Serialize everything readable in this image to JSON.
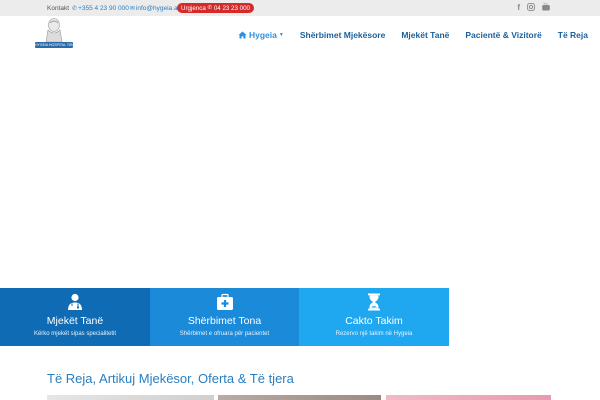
{
  "topbar": {
    "contact_label": "Kontakt",
    "phone": "+355 4 23 90 000",
    "email": "info@hygeia.al",
    "urgency_label": "Urgjenca",
    "urgency_phone": "04 23 23 000",
    "social": [
      "facebook-icon",
      "instagram-icon",
      "youtube-icon"
    ]
  },
  "logo": {
    "text": "HYGEIA HOSPITAL TIRANA"
  },
  "nav": {
    "items": [
      {
        "label": "Hygeia",
        "icon": "home-icon",
        "has_dropdown": true
      },
      {
        "label": "Shërbimet Mjekësore"
      },
      {
        "label": "Mjekët Tanë"
      },
      {
        "label": "Pacientë & Vizitorë"
      },
      {
        "label": "Të Reja"
      }
    ]
  },
  "features": [
    {
      "title": "Mjekët Tanë",
      "subtitle": "Kërko mjekët sipas specialitetit",
      "icon": "doctor-icon",
      "color": "#0f6bb4"
    },
    {
      "title": "Shërbimet Tona",
      "subtitle": "Shërbimet e ofruara për pacientet",
      "icon": "medical-kit-icon",
      "color": "#1a8ad9"
    },
    {
      "title": "Cakto Takim",
      "subtitle": "Rezervo një takim në Hygeia",
      "icon": "hourglass-icon",
      "color": "#1fa7f0"
    }
  ],
  "news": {
    "title": "Të Reja, Artikuj Mjekësor, Oferta & Të tjera"
  },
  "colors": {
    "accent": "#2a7ec0",
    "nav": "#1d5f99",
    "urgent": "#d42a2a"
  }
}
